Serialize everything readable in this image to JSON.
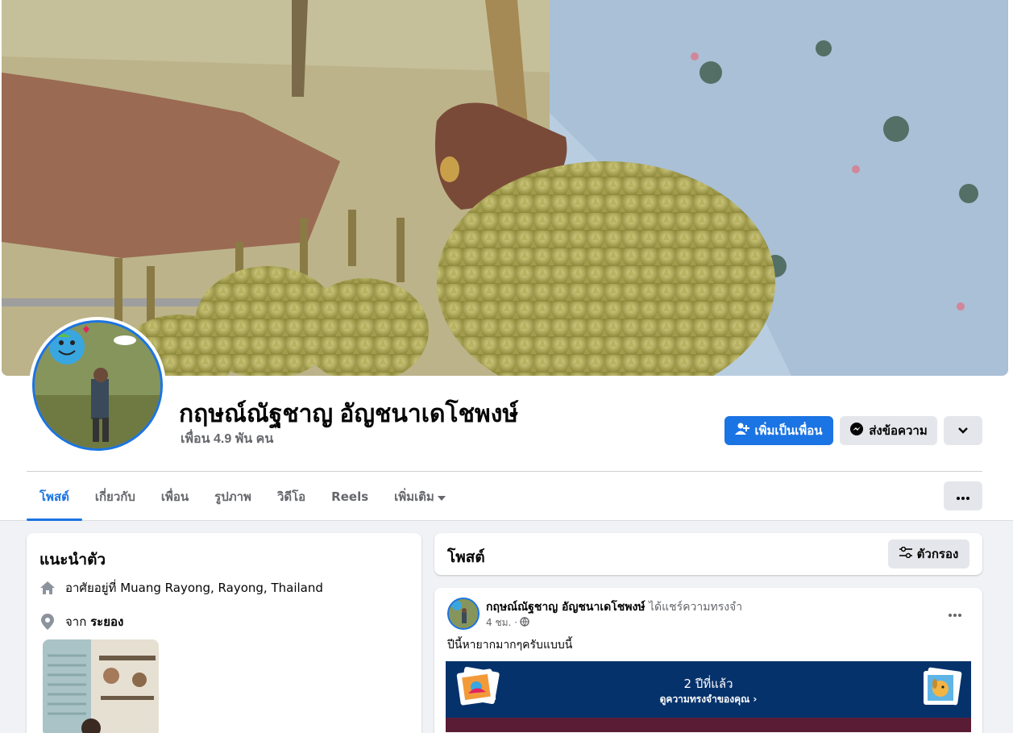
{
  "profile": {
    "name": "กฤษณ์ณัฐชาญ อัญชนาเดโชพงษ์",
    "friends_count": "เพื่อน 4.9 พัน คน"
  },
  "actions": {
    "add_friend": "เพิ่มเป็นเพื่อน",
    "message": "ส่งข้อความ"
  },
  "tabs": [
    {
      "label": "โพสต์",
      "active": true
    },
    {
      "label": "เกี่ยวกับ"
    },
    {
      "label": "เพื่อน"
    },
    {
      "label": "รูปภาพ"
    },
    {
      "label": "วิดีโอ"
    },
    {
      "label": "Reels"
    },
    {
      "label": "เพิ่มเติม"
    }
  ],
  "intro": {
    "title": "แนะนำตัว",
    "lives_in_prefix": "อาศัยอยู่ที่",
    "lives_in": "Muang Rayong, Rayong, Thailand",
    "from_prefix": "จาก",
    "from": "ระยอง"
  },
  "posts": {
    "title": "โพสต์",
    "filter_label": "ตัวกรอง"
  },
  "post": {
    "author": "กฤษณ์ณัฐชาญ อัญชนาเดโชพงษ์",
    "action": "ได้แชร์ความทรงจำ",
    "time": "4 ชม. ·",
    "text": "ปีนี้หายากมากๆครับแบบนี้",
    "memory_title": "2 ปีที่แล้ว",
    "memory_link": "ดูความทรงจำของคุณ ›"
  },
  "colors": {
    "accent": "#1b74e4",
    "memory_bg": "#06326b"
  }
}
